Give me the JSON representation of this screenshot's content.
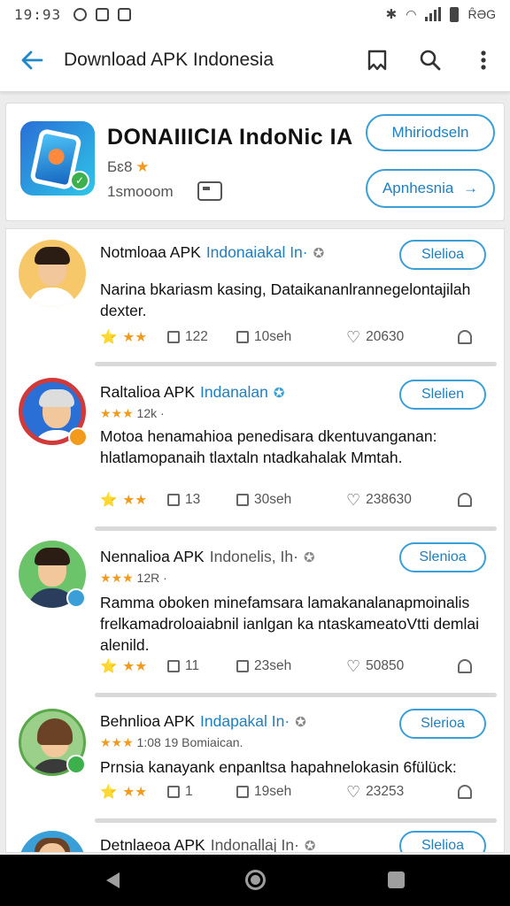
{
  "status_bar": {
    "time": "19:93",
    "battery_text": "ȒƏG"
  },
  "app_bar": {
    "title": "Download APK Indonesia"
  },
  "summary": {
    "app_title": "DONAIIICIA IndoNic IA",
    "rating_label": "Бɛ8",
    "star": "★",
    "downloads": "1smooom",
    "button_primary": "Mhiriodseln",
    "button_secondary": "Apnhesnia",
    "button_secondary_arrow": "→"
  },
  "posts": [
    {
      "name": "Notmloaa APK",
      "handle": "Indonaiakal In·",
      "verify": "✪",
      "follow": "Slelioa",
      "text": "Narina bkariasm kasing, Dataikananlrannegelontajilah dexter.",
      "actions": {
        "stars": "★★",
        "lead": "⭐",
        "comments": "122",
        "reposts": "10seh",
        "likes": "20630"
      }
    },
    {
      "name": "Raltalioa APK",
      "handle": "Indanalan",
      "verify": "✪",
      "meta_stars": "★★★",
      "meta": "12k ·",
      "follow": "Slelien",
      "text": "Motoa henamahioa penedisara dkentuvanganan: hlatlamopanaih tlaxtaln ntadkahalak Mmtah.",
      "actions": {
        "stars": "★★",
        "lead": "⭐",
        "comments": "13",
        "reposts": "30seh",
        "likes": "238630"
      }
    },
    {
      "name": "Nennalioa APK",
      "handle": "Indonelis, Ih·",
      "verify": "✪",
      "meta_stars": "★★★",
      "meta": "12R ·",
      "follow": "Slenioa",
      "text": "Ramma oboken minefamsara lamakanalanapmoinalis frelkamadroloaiabnil ianlgan ka ntaskameatoVtti demlai alenild.",
      "actions": {
        "stars": "★★",
        "lead": "⭐",
        "comments": "11",
        "reposts": "23seh",
        "likes": "50850"
      }
    },
    {
      "name": "Behnlioa APK",
      "handle": "Indapakal In·",
      "verify": "✪",
      "meta_stars": "★★★",
      "meta": "1:08 19 Bomiaican.",
      "follow": "Slerioa",
      "text": "Prnsia kanayank enpanltsa hapahnelokasin 6fülück:",
      "actions": {
        "stars": "★★",
        "lead": "⭐",
        "comments": "1",
        "reposts": "19seh",
        "likes": "23253"
      }
    },
    {
      "name": "Detnlaeoa APK",
      "handle": "Indonallaj In·",
      "verify": "✪",
      "follow": "Slelioa"
    }
  ],
  "icons": {
    "back": "arrow-left-icon",
    "bookmark": "bookmark-icon",
    "search": "search-icon",
    "more": "more-vert-icon",
    "comment": "comment-icon",
    "repost": "repost-icon",
    "like": "heart-icon",
    "profile": "person-icon"
  },
  "colors": {
    "accent": "#1e88c8",
    "star": "#f29a1b",
    "verified": "#3cb04a",
    "navbar": "#000000"
  }
}
